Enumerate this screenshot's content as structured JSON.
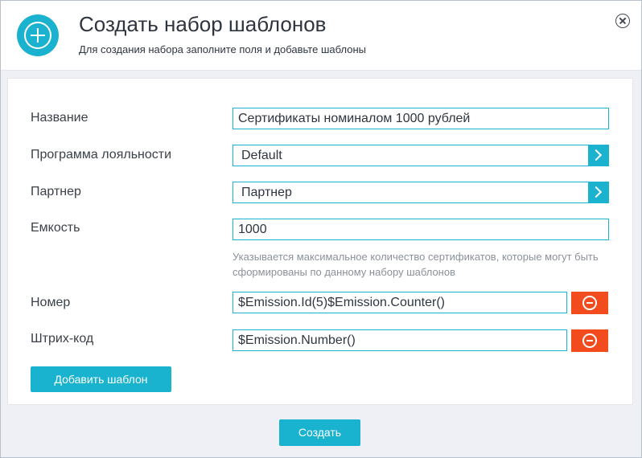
{
  "header": {
    "title": "Создать набор шаблонов",
    "subtitle": "Для создания набора заполните поля и добавьте шаблоны"
  },
  "form": {
    "name_label": "Название",
    "name_value": "Сертификаты номиналом 1000 рублей",
    "program_label": "Программа лояльности",
    "program_value": "Default",
    "partner_label": "Партнер",
    "partner_value": "Партнер",
    "capacity_label": "Емкость",
    "capacity_value": "1000",
    "capacity_hint": "Указывается максимальное количество сертификатов, которые могут быть сформированы по данному набору шаблонов",
    "number_label": "Номер",
    "number_value": "$Emission.Id(5)$Emission.Counter()",
    "barcode_label": "Штрих-код",
    "barcode_value": "$Emission.Number()"
  },
  "buttons": {
    "add_template": "Добавить шаблон",
    "create": "Создать"
  },
  "colors": {
    "accent": "#19b3cf",
    "danger": "#f24b1e"
  }
}
